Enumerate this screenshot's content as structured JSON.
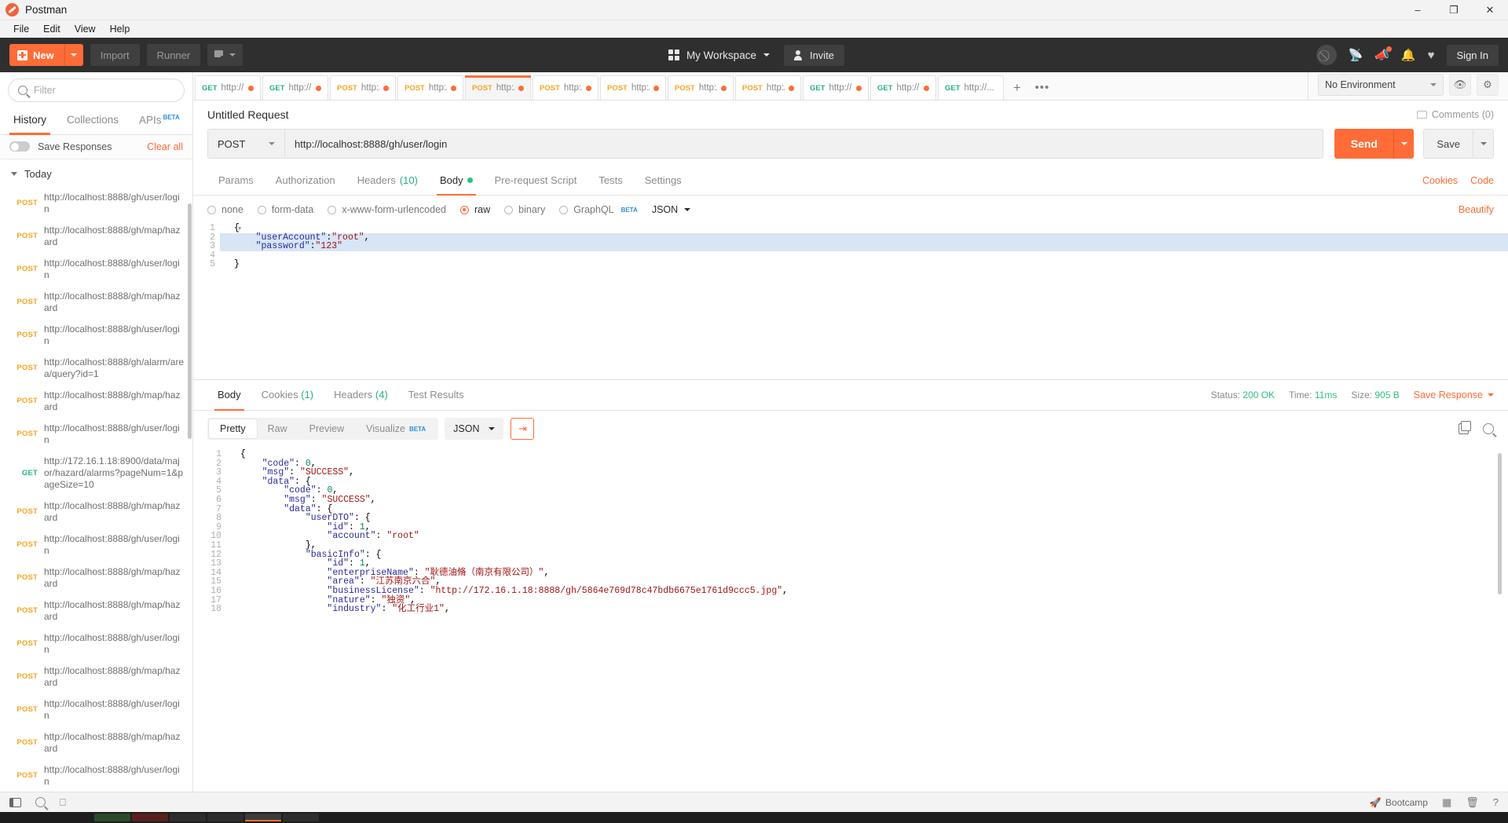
{
  "window": {
    "title": "Postman",
    "minimize": "–",
    "maximize": "❐",
    "close": "✕"
  },
  "menubar": {
    "items": [
      "File",
      "Edit",
      "View",
      "Help"
    ]
  },
  "toolbar": {
    "new_label": "New",
    "import_label": "Import",
    "runner_label": "Runner",
    "workspace_label": "My Workspace",
    "invite_label": "Invite",
    "signin_label": "Sign In"
  },
  "sidebar": {
    "filter_placeholder": "Filter",
    "tabs": [
      {
        "label": "History",
        "active": true,
        "beta": ""
      },
      {
        "label": "Collections",
        "active": false,
        "beta": ""
      },
      {
        "label": "APIs",
        "active": false,
        "beta": "BETA"
      }
    ],
    "save_responses_label": "Save Responses",
    "clear_all_label": "Clear all",
    "group_label": "Today",
    "history": [
      {
        "method": "POST",
        "url": "http://localhost:8888/gh/user/login"
      },
      {
        "method": "POST",
        "url": "http://localhost:8888/gh/map/hazard"
      },
      {
        "method": "POST",
        "url": "http://localhost:8888/gh/user/login"
      },
      {
        "method": "POST",
        "url": "http://localhost:8888/gh/map/hazard"
      },
      {
        "method": "POST",
        "url": "http://localhost:8888/gh/user/login"
      },
      {
        "method": "POST",
        "url": "http://localhost:8888/gh/alarm/area/query?id=1"
      },
      {
        "method": "POST",
        "url": "http://localhost:8888/gh/map/hazard"
      },
      {
        "method": "POST",
        "url": "http://localhost:8888/gh/user/login"
      },
      {
        "method": "GET",
        "url": "http://172.16.1.18:8900/data/major/hazard/alarms?pageNum=1&pageSize=10"
      },
      {
        "method": "POST",
        "url": "http://localhost:8888/gh/map/hazard"
      },
      {
        "method": "POST",
        "url": "http://localhost:8888/gh/user/login"
      },
      {
        "method": "POST",
        "url": "http://localhost:8888/gh/map/hazard"
      },
      {
        "method": "POST",
        "url": "http://localhost:8888/gh/map/hazard"
      },
      {
        "method": "POST",
        "url": "http://localhost:8888/gh/user/login"
      },
      {
        "method": "POST",
        "url": "http://localhost:8888/gh/map/hazard"
      },
      {
        "method": "POST",
        "url": "http://localhost:8888/gh/user/login"
      },
      {
        "method": "POST",
        "url": "http://localhost:8888/gh/map/hazard"
      },
      {
        "method": "POST",
        "url": "http://localhost:8888/gh/user/login"
      }
    ]
  },
  "request_tabs": [
    {
      "method": "GET",
      "url": "http://1...",
      "dirty": true,
      "active": false
    },
    {
      "method": "GET",
      "url": "http://1...",
      "dirty": true,
      "active": false
    },
    {
      "method": "POST",
      "url": "http://...",
      "dirty": true,
      "active": false
    },
    {
      "method": "POST",
      "url": "http://l...",
      "dirty": true,
      "active": false
    },
    {
      "method": "POST",
      "url": "http://l...",
      "dirty": true,
      "active": true
    },
    {
      "method": "POST",
      "url": "http://l...",
      "dirty": true,
      "active": false
    },
    {
      "method": "POST",
      "url": "http://l...",
      "dirty": true,
      "active": false
    },
    {
      "method": "POST",
      "url": "http://l...",
      "dirty": true,
      "active": false
    },
    {
      "method": "POST",
      "url": "http://l...",
      "dirty": true,
      "active": false
    },
    {
      "method": "GET",
      "url": "http://1...",
      "dirty": true,
      "active": false
    },
    {
      "method": "GET",
      "url": "http://l...",
      "dirty": true,
      "active": false
    },
    {
      "method": "GET",
      "url": "http://...",
      "dirty": false,
      "active": false
    }
  ],
  "tabbar": {
    "add_label": "+",
    "more_label": "•••"
  },
  "environment": {
    "selected": "No Environment",
    "eye_icon": "eye-icon",
    "gear_icon": "gear-icon"
  },
  "request": {
    "name": "Untitled Request",
    "comments_label": "Comments (0)",
    "method": "POST",
    "url": "http://localhost:8888/gh/user/login",
    "send_label": "Send",
    "save_label": "Save",
    "tabs": [
      {
        "label": "Params",
        "active": false
      },
      {
        "label": "Authorization",
        "active": false
      },
      {
        "label": "Headers",
        "count": "(10)",
        "active": false
      },
      {
        "label": "Body",
        "active": true,
        "dot": true
      },
      {
        "label": "Pre-request Script",
        "active": false
      },
      {
        "label": "Tests",
        "active": false
      },
      {
        "label": "Settings",
        "active": false
      }
    ],
    "cookies_link": "Cookies",
    "code_link": "Code",
    "body_modes": [
      {
        "label": "none",
        "on": false
      },
      {
        "label": "form-data",
        "on": false
      },
      {
        "label": "x-www-form-urlencoded",
        "on": false
      },
      {
        "label": "raw",
        "on": true
      },
      {
        "label": "binary",
        "on": false
      },
      {
        "label": "GraphQL",
        "on": false,
        "beta": "BETA"
      }
    ],
    "content_type": "JSON",
    "beautify_label": "Beautify",
    "body_lines": [
      {
        "n": "1",
        "fold": true,
        "text": "{",
        "hl": false
      },
      {
        "n": "2",
        "fold": false,
        "text": "    \"userAccount\":\"root\",",
        "hl": true
      },
      {
        "n": "3",
        "fold": false,
        "text": "    \"password\":\"123\"",
        "hl": true
      },
      {
        "n": "4",
        "fold": false,
        "text": "",
        "hl": false
      },
      {
        "n": "5",
        "fold": false,
        "text": "}",
        "hl": false
      }
    ]
  },
  "response": {
    "tabs": [
      {
        "label": "Body",
        "active": true
      },
      {
        "label": "Cookies",
        "count": "(1)",
        "active": false
      },
      {
        "label": "Headers",
        "count": "(4)",
        "active": false
      },
      {
        "label": "Test Results",
        "active": false
      }
    ],
    "status_label": "Status:",
    "status_value": "200 OK",
    "time_label": "Time:",
    "time_value": "11ms",
    "size_label": "Size:",
    "size_value": "905 B",
    "save_response_label": "Save Response",
    "view_modes": [
      {
        "label": "Pretty",
        "active": true
      },
      {
        "label": "Raw",
        "active": false
      },
      {
        "label": "Preview",
        "active": false
      },
      {
        "label": "Visualize",
        "active": false,
        "beta": "BETA"
      }
    ],
    "format": "JSON",
    "wrap_icon": "word-wrap-icon",
    "copy_icon": "copy-icon",
    "search_icon": "search-icon",
    "body_lines": [
      {
        "n": "1",
        "text": "{"
      },
      {
        "n": "2",
        "text": "    \"code\": 0,"
      },
      {
        "n": "3",
        "text": "    \"msg\": \"SUCCESS\","
      },
      {
        "n": "4",
        "text": "    \"data\": {"
      },
      {
        "n": "5",
        "text": "        \"code\": 0,"
      },
      {
        "n": "6",
        "text": "        \"msg\": \"SUCCESS\","
      },
      {
        "n": "7",
        "text": "        \"data\": {"
      },
      {
        "n": "8",
        "text": "            \"userDTO\": {"
      },
      {
        "n": "9",
        "text": "                \"id\": 1,"
      },
      {
        "n": "10",
        "text": "                \"account\": \"root\""
      },
      {
        "n": "11",
        "text": "            },"
      },
      {
        "n": "12",
        "text": "            \"basicInfo\": {"
      },
      {
        "n": "13",
        "text": "                \"id\": 1,"
      },
      {
        "n": "14",
        "text": "                \"enterpriseName\": \"耿德油脩（南京有限公司）\","
      },
      {
        "n": "15",
        "text": "                \"area\": \"江苏南京六合\","
      },
      {
        "n": "16",
        "text": "                \"businessLicense\": \"http://172.16.1.18:8888/gh/5864e769d78c47bdb6675e1761d9ccc5.jpg\","
      },
      {
        "n": "17",
        "text": "                \"nature\": \"独资\","
      },
      {
        "n": "18",
        "text": "                \"industry\": \"化工行业1\","
      }
    ]
  },
  "statusbar": {
    "find_icon": "search-icon",
    "console_icon": "console-icon",
    "layout_icon": "sidebar-toggle-icon",
    "bootcamp_label": "Bootcamp",
    "grid_icon": "two-pane-icon",
    "trash_icon": "trash-icon",
    "help_icon": "help-icon"
  },
  "colors": {
    "accent": "#ff6c37",
    "get": "#27b080",
    "post": "#f5a623",
    "success": "#2ec27e",
    "dark": "#2f2f2f"
  }
}
